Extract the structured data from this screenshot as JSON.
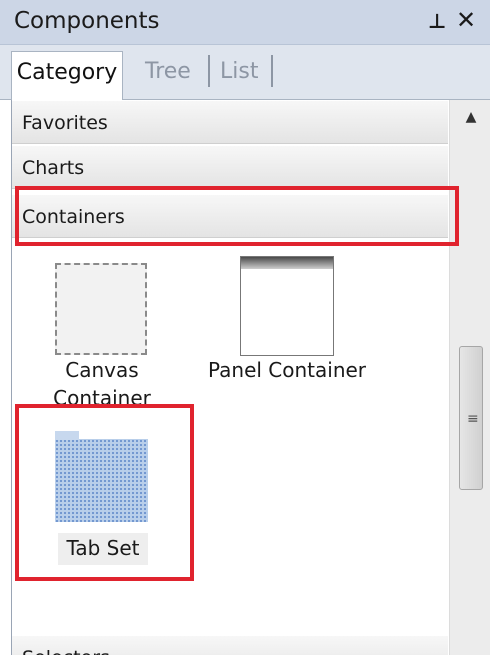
{
  "window": {
    "title": "Components",
    "pin_glyph": "⊥",
    "close_glyph": "✕"
  },
  "tabs": [
    {
      "label": "Category",
      "active": true
    },
    {
      "label": "Tree",
      "active": false
    },
    {
      "label": "List",
      "active": false
    }
  ],
  "categories": {
    "favorites": "Favorites",
    "charts": "Charts",
    "containers": "Containers",
    "selectors": "Selectors"
  },
  "components": {
    "canvas_line1": "Canvas",
    "canvas_line2": "Container",
    "panel": "Panel Container",
    "tabset": "Tab Set"
  },
  "scrollbar": {
    "up_glyph": "▲",
    "grip_glyph": "≡"
  },
  "colors": {
    "highlight": "#e0232e",
    "titlebar": "#ccd6e6"
  }
}
